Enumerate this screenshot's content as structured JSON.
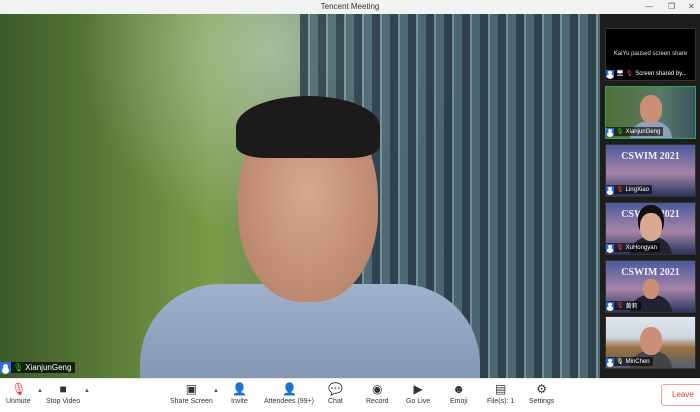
{
  "window": {
    "title": "Tencent Meeting",
    "min": "—",
    "restore": "❐",
    "close": "✕"
  },
  "main_video": {
    "speaker": "XianjunGeng"
  },
  "sidebar": {
    "share_tile": {
      "message": "KaiYu paused screen share",
      "label": "Screen shared by..."
    },
    "participants": [
      {
        "name": "XianjunGeng",
        "muted": false,
        "banner": ""
      },
      {
        "name": "LingXiao",
        "muted": true,
        "banner": "CSWIM 2021"
      },
      {
        "name": "XuHongyan",
        "muted": true,
        "banner": "CSWIM 2021"
      },
      {
        "name": "黄莉",
        "muted": true,
        "banner": "CSWIM 2021"
      },
      {
        "name": "MinChen",
        "muted": false,
        "banner": ""
      }
    ]
  },
  "toolbar": {
    "unmute": "Unmute",
    "stop_video": "Stop Video",
    "share_screen": "Share Screen",
    "invite": "Invite",
    "attendees": "Attendees (99+)",
    "chat": "Chat",
    "record": "Record",
    "go_live": "Go Live",
    "emoji": "Emoji",
    "files": "File(s): 1",
    "settings": "Settings",
    "leave": "Leave"
  },
  "colors": {
    "accent": "#2a6de0",
    "leave": "#e33333",
    "active_speaker": "#2da44e"
  }
}
